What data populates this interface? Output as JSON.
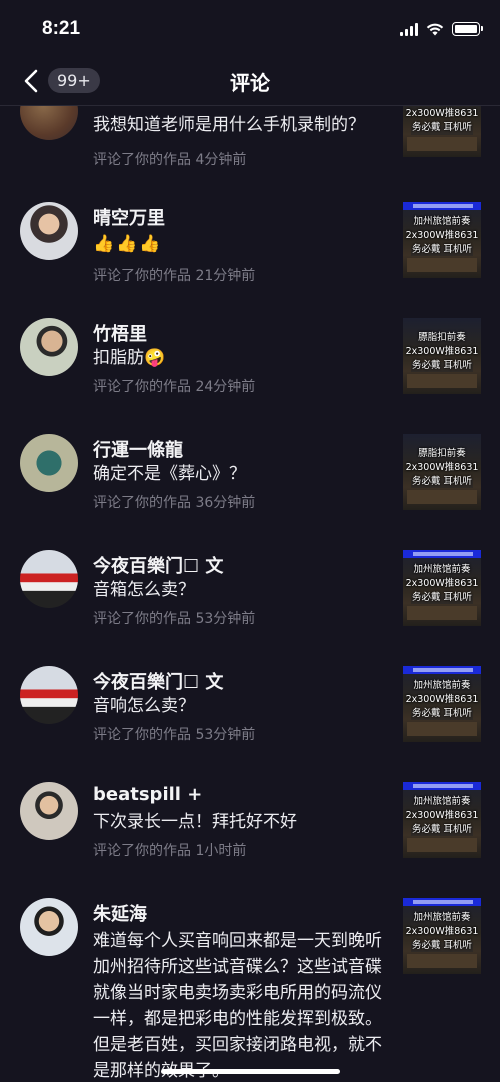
{
  "status": {
    "time": "8:21"
  },
  "nav": {
    "back_badge": "99+",
    "title": "评论"
  },
  "items": [
    {
      "name": "",
      "comment": "我想知道老师是用什么手机录制的？",
      "meta": "评论了你的作品 4分钟前",
      "thumb": [
        "",
        "2x300W推8631",
        "务必戴  耳机听"
      ]
    },
    {
      "name": "晴空万里",
      "comment": "👍👍👍",
      "meta": "评论了你的作品 21分钟前",
      "thumb": [
        "加州旅馆前奏",
        "2x300W推8631",
        "务必戴  耳机听"
      ]
    },
    {
      "name": "竹梧里",
      "comment": "扣脂肪🤪",
      "meta": "评论了你的作品 24分钟前",
      "thumb": [
        "膘脂扣前奏",
        "2x300W推8631",
        "务必戴  耳机听"
      ]
    },
    {
      "name": "行運一條龍",
      "comment": "确定不是《葬心》？",
      "meta": "评论了你的作品 36分钟前",
      "thumb": [
        "膘脂扣前奏",
        "2x300W推8631",
        "务必戴  耳机听"
      ]
    },
    {
      "name": "今夜百樂门☐ 文",
      "comment": "音箱怎么卖？",
      "meta": "评论了你的作品 53分钟前",
      "thumb": [
        "加州旅馆前奏",
        "2x300W推8631",
        "务必戴  耳机听"
      ]
    },
    {
      "name": "今夜百樂门☐ 文",
      "comment": "音响怎么卖？",
      "meta": "评论了你的作品 53分钟前",
      "thumb": [
        "加州旅馆前奏",
        "2x300W推8631",
        "务必戴  耳机听"
      ]
    },
    {
      "name": "beatspill +",
      "comment": "下次录长一点！拜托好不好",
      "meta": "评论了你的作品 1小时前",
      "thumb": [
        "加州旅馆前奏",
        "2x300W推8631",
        "务必戴  耳机听"
      ]
    },
    {
      "name": "朱延海",
      "comment": "难道每个人买音响回来都是一天到晚听加州招待所这些试音碟么？这些试音碟就像当时家电卖场卖彩电所用的码流仪一样，都是把彩电的性能发挥到极致。但是老百姓，买回家接闭路电视，就不是那样的效果了。",
      "meta": "",
      "thumb": [
        "加州旅馆前奏",
        "2x300W推8631",
        "务必戴  耳机听"
      ]
    }
  ]
}
